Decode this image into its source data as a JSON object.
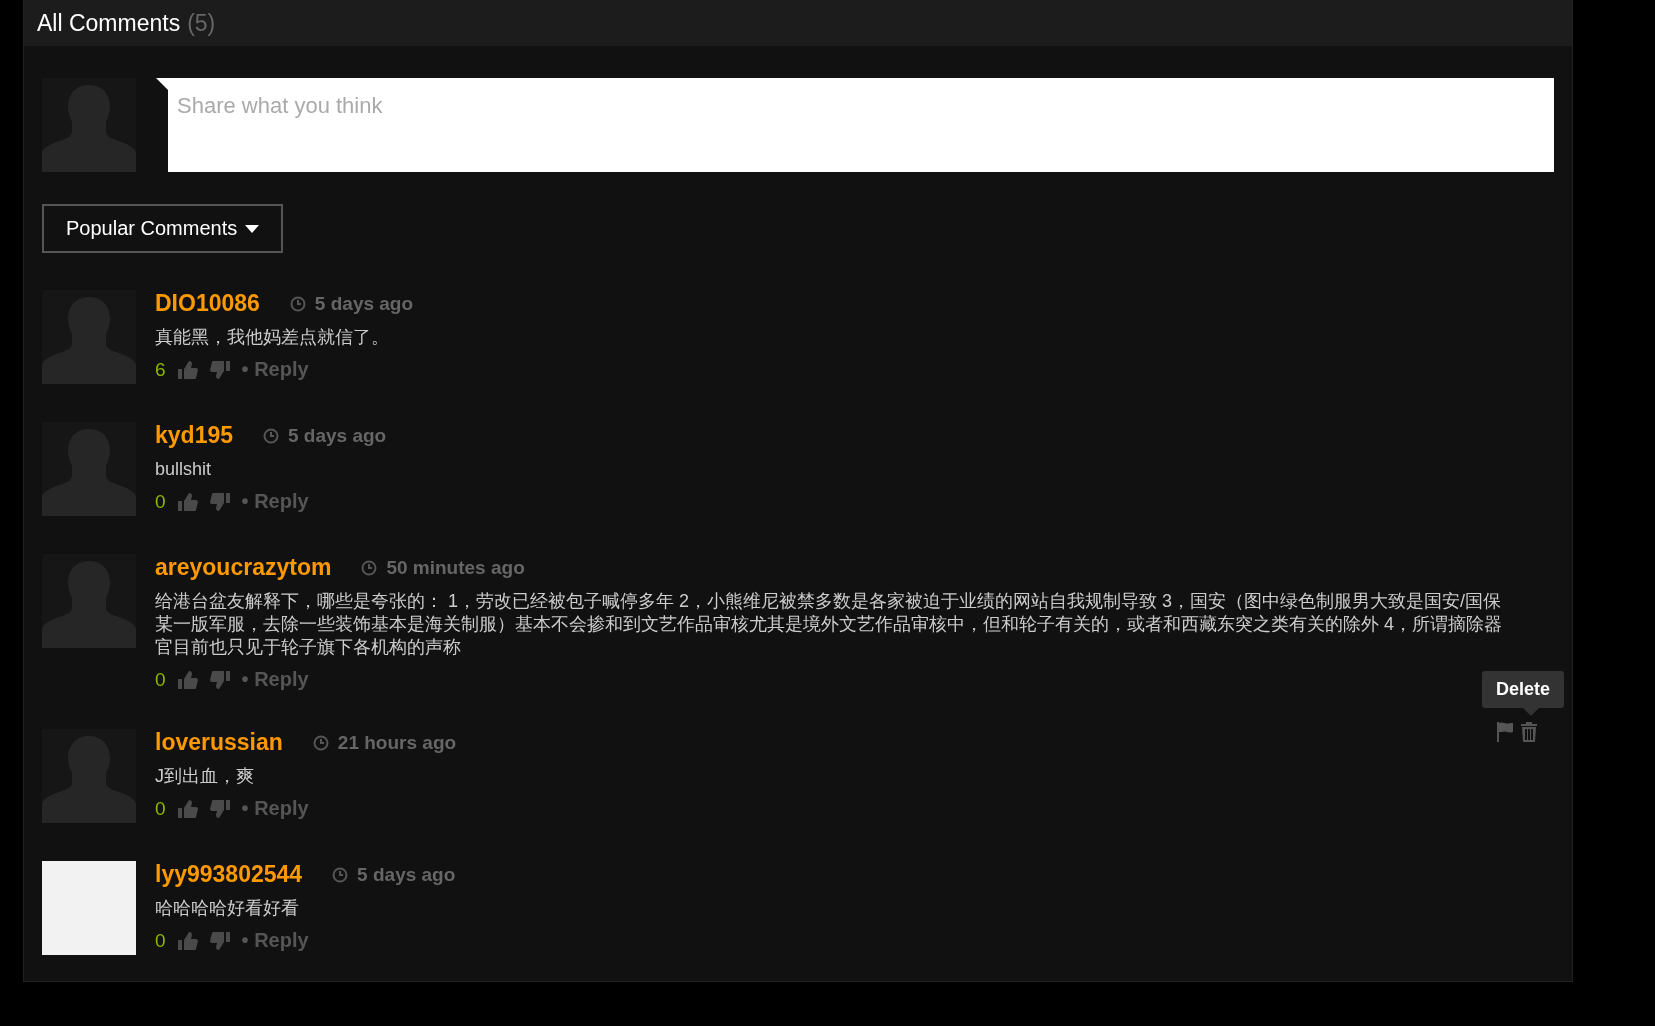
{
  "header": {
    "title": "All Comments",
    "count": "(5)"
  },
  "composer": {
    "placeholder": "Share what you think"
  },
  "sort": {
    "label": "Popular Comments"
  },
  "comments": [
    {
      "kind": "silhouette",
      "user": "DIO10086",
      "time": "5 days ago",
      "text": "真能黑，我他妈差点就信了。",
      "votes": "6",
      "reply": "• Reply"
    },
    {
      "kind": "silhouette",
      "user": "kyd195",
      "time": "5 days ago",
      "text": "bullshit",
      "votes": "0",
      "reply": "• Reply"
    },
    {
      "kind": "silhouette",
      "user": "areyoucrazytom",
      "time": "50 minutes ago",
      "text": "给港台盆友解释下，哪些是夸张的： 1，劳改已经被包子喊停多年 2，小熊维尼被禁多数是各家被迫于业绩的网站自我规制导致 3，国安（图中绿色制服男大致是国安/国保某一版军服，去除一些装饰基本是海关制服）基本不会掺和到文艺作品审核尤其是境外文艺作品审核中，但和轮子有关的，或者和西藏东突之类有关的除外 4，所谓摘除器官目前也只见于轮子旗下各机构的声称",
      "votes": "0",
      "reply": "• Reply"
    },
    {
      "kind": "silhouette",
      "user": "loverussian",
      "time": "21 hours ago",
      "text": "J到出血，爽",
      "votes": "0",
      "reply": "• Reply",
      "tooltip": "Delete"
    },
    {
      "kind": "photo",
      "user": "lyy993802544",
      "time": "5 days ago",
      "text": "哈哈哈哈好看好看",
      "votes": "0",
      "reply": "• Reply"
    }
  ]
}
